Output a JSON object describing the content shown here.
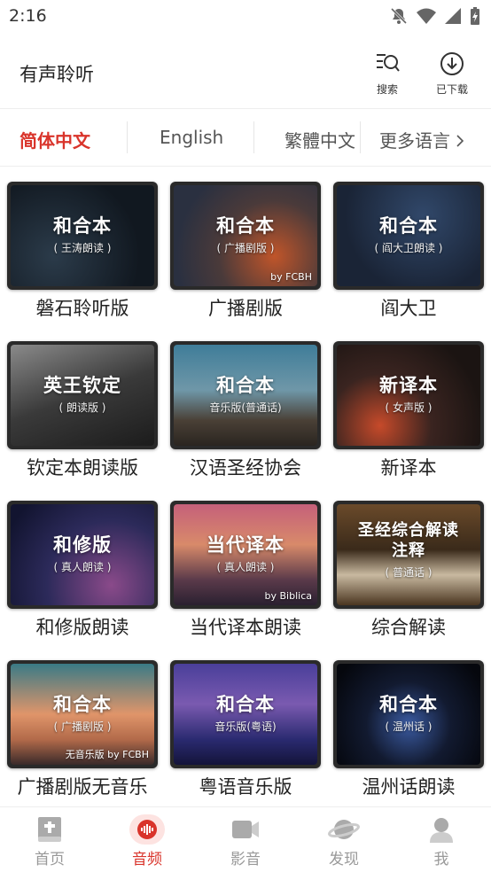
{
  "status": {
    "time": "2:16"
  },
  "header": {
    "title": "有声聆听",
    "search_label": "搜索",
    "downloaded_label": "已下载"
  },
  "tabs": [
    {
      "label": "简体中文",
      "active": true
    },
    {
      "label": "English"
    },
    {
      "label": "繁體中文"
    },
    {
      "label": "更多语言"
    }
  ],
  "cards": [
    {
      "title": "和合本",
      "sub": "( 王涛朗读 )",
      "credit": "",
      "label": "磐石聆听版"
    },
    {
      "title": "和合本",
      "sub": "( 广播剧版 )",
      "credit": "by FCBH",
      "label": "广播剧版"
    },
    {
      "title": "和合本",
      "sub": "( 阎大卫朗读 )",
      "credit": "",
      "label": "阎大卫"
    },
    {
      "title": "英王钦定",
      "sub": "( 朗读版 )",
      "credit": "",
      "label": "钦定本朗读版"
    },
    {
      "title": "和合本",
      "sub": "音乐版(普通话)",
      "credit": "",
      "label": "汉语圣经协会"
    },
    {
      "title": "新译本",
      "sub": "( 女声版 )",
      "credit": "",
      "label": "新译本"
    },
    {
      "title": "和修版",
      "sub": "( 真人朗读 )",
      "credit": "",
      "label": "和修版朗读"
    },
    {
      "title": "当代译本",
      "sub": "( 真人朗读 )",
      "credit": "by Biblica",
      "label": "当代译本朗读"
    },
    {
      "title": "圣经综合解读注释",
      "sub": "( 普通话 )",
      "credit": "",
      "label": "综合解读"
    },
    {
      "title": "和合本",
      "sub": "( 广播剧版 )",
      "credit": "无音乐版 by FCBH",
      "label": "广播剧版无音乐"
    },
    {
      "title": "和合本",
      "sub": "音乐版(粤语)",
      "credit": "",
      "label": "粤语音乐版"
    },
    {
      "title": "和合本",
      "sub": "( 温州话 )",
      "credit": "",
      "label": "温州话朗读"
    }
  ],
  "nav": [
    {
      "label": "首页",
      "icon": "bible-icon"
    },
    {
      "label": "音频",
      "icon": "audio-wave-icon",
      "active": true
    },
    {
      "label": "影音",
      "icon": "video-camera-icon"
    },
    {
      "label": "发现",
      "icon": "planet-icon"
    },
    {
      "label": "我",
      "icon": "person-icon"
    }
  ],
  "colors": {
    "accent": "#d9342b",
    "inactive": "#999999"
  }
}
